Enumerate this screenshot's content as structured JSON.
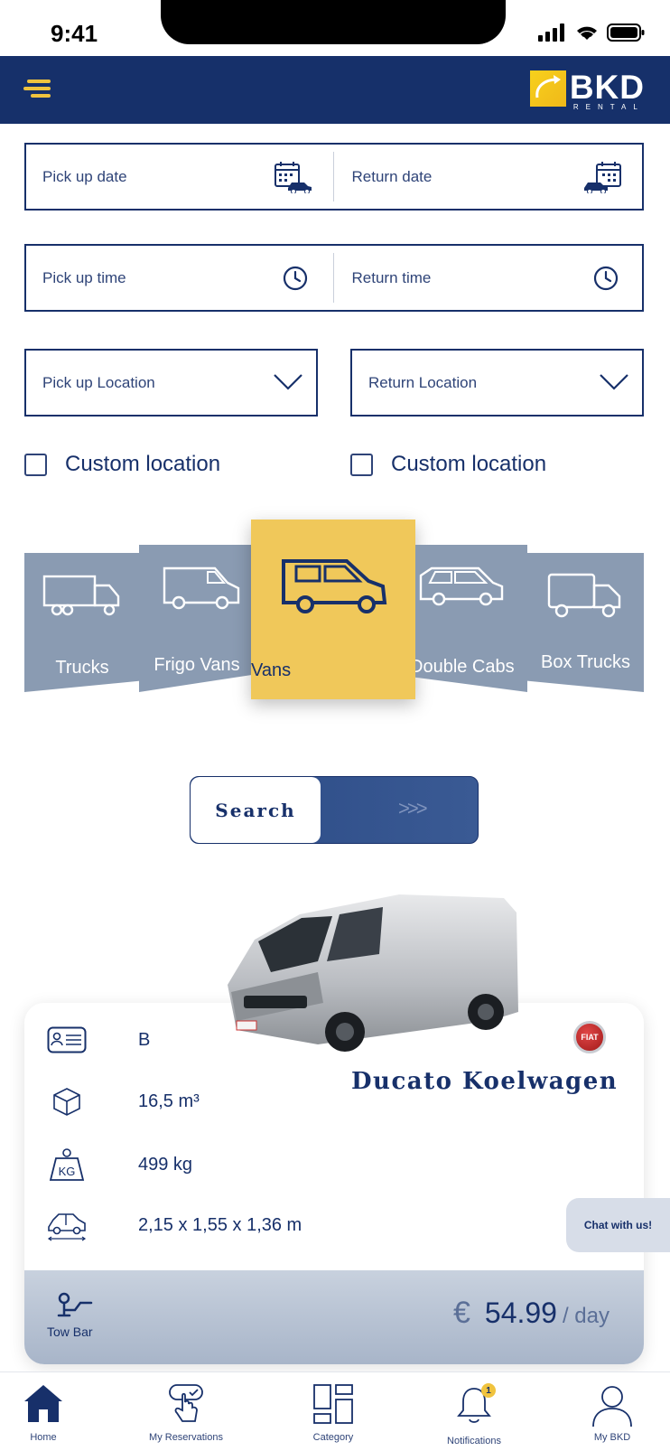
{
  "status_bar": {
    "time": "9:41"
  },
  "header": {
    "brand": "BKD",
    "brand_sub": "RENTAL"
  },
  "form": {
    "pickup_date": "Pick up date",
    "return_date": "Return date",
    "pickup_time": "Pick up time",
    "return_time": "Return time",
    "pickup_location": "Pick up Location",
    "return_location": "Return Location",
    "custom_location_left": "Custom location",
    "custom_location_right": "Custom location"
  },
  "categories": [
    {
      "label": "Trucks",
      "active": false
    },
    {
      "label": "Frigo Vans",
      "active": false
    },
    {
      "label": "Vans",
      "active": true
    },
    {
      "label": "Double Cabs",
      "active": false
    },
    {
      "label": "Box Trucks",
      "active": false
    }
  ],
  "search": {
    "label": "Search",
    "arrows": ">>>"
  },
  "vehicle": {
    "name": "Ducato Koelwagen",
    "brand_badge": "FIAT",
    "license": "B",
    "volume": "16,5 m³",
    "weight": "499 kg",
    "dimensions": "2,15 x 1,55 x 1,36 m",
    "tow_bar": "Tow Bar",
    "currency": "€",
    "price": "54.99",
    "unit": "/ day"
  },
  "chat": {
    "label": "Chat with us!"
  },
  "bottom_nav": {
    "home": "Home",
    "reservations": "My Reservations",
    "category": "Category",
    "notifications": "Notifications",
    "notifications_count": "1",
    "my_bkd": "My BKD"
  },
  "colors": {
    "navy": "#16306a",
    "accent_yellow": "#f0c85a",
    "category_grey": "#8a9bb2"
  }
}
